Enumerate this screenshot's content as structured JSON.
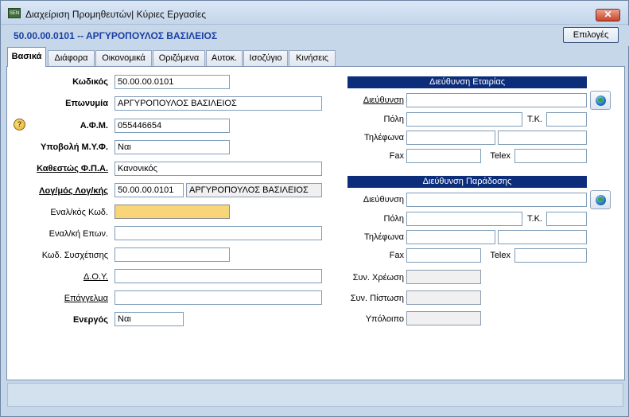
{
  "window": {
    "title": "Διαχείριση Προμηθευτών| Κύριες Εργασίες",
    "close": "✕",
    "app_icon": "app-icon"
  },
  "header": {
    "record": "50.00.00.0101 -- ΑΡΓΥΡΟΠΟΥΛΟΣ ΒΑΣΙΛΕΙΟΣ",
    "options": "Επιλογές"
  },
  "tabs": [
    "Βασικά",
    "Διάφορα",
    "Οικονομικά",
    "Οριζόμενα",
    "Αυτοκ.",
    "Ισοζύγιο",
    "Κινήσεις"
  ],
  "left": {
    "code": {
      "label": "Κωδικός",
      "value": "50.00.00.0101"
    },
    "name": {
      "label": "Επωνυμία",
      "value": "ΑΡΓΥΡΟΠΟΥΛΟΣ ΒΑΣΙΛΕΙΟΣ"
    },
    "afm": {
      "label": "Α.Φ.Μ.",
      "value": "055446654"
    },
    "myf": {
      "label": "Υποβολή Μ.Υ.Φ.",
      "value": "Ναι"
    },
    "vat": {
      "label": "Καθεστώς Φ.Π.Α.",
      "value": "Κανονικός"
    },
    "account": {
      "label": "Λογ/μός Λογ/κής",
      "value": "50.00.00.0101",
      "desc": "ΑΡΓΥΡΟΠΟΥΛΟΣ ΒΑΣΙΛΕΙΟΣ"
    },
    "alt_code": {
      "label": "Εναλ/κός Κωδ.",
      "value": ""
    },
    "alt_name": {
      "label": "Εναλ/κή Επων.",
      "value": ""
    },
    "rel_code": {
      "label": "Κωδ. Συσχέτισης",
      "value": ""
    },
    "doy": {
      "label": "Δ.Ο.Υ.",
      "value": ""
    },
    "profession": {
      "label": "Επάγγελμα",
      "value": ""
    },
    "active": {
      "label": "Ενεργός",
      "value": "Ναι"
    }
  },
  "company_address": {
    "title": "Διεύθυνση Εταιρίας",
    "address_label": "Διεύθυνση",
    "city_label": "Πόλη",
    "tk_label": "Τ.Κ.",
    "phones_label": "Τηλέφωνα",
    "fax_label": "Fax",
    "telex_label": "Telex"
  },
  "delivery_address": {
    "title": "Διεύθυνση Παράδοσης",
    "address_label": "Διεύθυνση",
    "city_label": "Πόλη",
    "tk_label": "Τ.Κ.",
    "phones_label": "Τηλέφωνα",
    "fax_label": "Fax",
    "telex_label": "Telex"
  },
  "balances": {
    "debit": "Συν. Χρέωση",
    "credit": "Συν. Πίστωση",
    "balance": "Υπόλοιπο"
  }
}
